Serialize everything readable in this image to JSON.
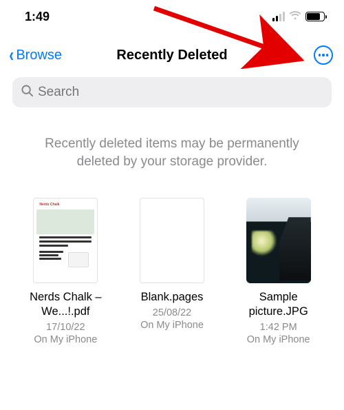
{
  "status": {
    "time": "1:49"
  },
  "nav": {
    "back_label": "Browse",
    "title": "Recently Deleted"
  },
  "search": {
    "placeholder": "Search"
  },
  "info_message": "Recently deleted items may be permanently deleted by your storage provider.",
  "files": [
    {
      "name": "Nerds Chalk – We...!.pdf",
      "date": "17/10/22",
      "location": "On My iPhone"
    },
    {
      "name": "Blank.pages",
      "date": "25/08/22",
      "location": "On My iPhone"
    },
    {
      "name": "Sample picture.JPG",
      "date": "1:42 PM",
      "location": "On My iPhone"
    }
  ],
  "accent_color": "#007aff"
}
